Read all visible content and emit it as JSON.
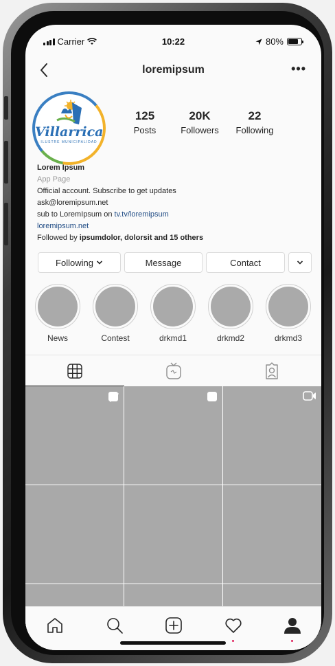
{
  "status_bar": {
    "carrier": "Carrier",
    "time": "10:22",
    "battery": "80%",
    "battery_level": 0.8
  },
  "header": {
    "username": "loremipsum",
    "more": "•••"
  },
  "profile": {
    "logo": {
      "text": "Villarrica",
      "subtitle": "ILUSTRE MUNICIPALIDAD"
    },
    "stats": [
      {
        "value": "125",
        "label": "Posts"
      },
      {
        "value": "20K",
        "label": "Followers"
      },
      {
        "value": "22",
        "label": "Following"
      }
    ],
    "name": "Lorem Ipsum",
    "category": "App Page",
    "bio_line": "Official account. Subscribe to get updates",
    "email": "ask@loremipsum.net",
    "sub_prefix": "sub to LoremIpsum on ",
    "sub_link": "tv.tv/loremipsum",
    "website": "loremipsum.net",
    "followed_prefix": "Followed by ",
    "followed_names": "ipsumdolor, dolorsit and 15 others"
  },
  "actions": {
    "following": "Following",
    "message": "Message",
    "contact": "Contact"
  },
  "highlights": [
    "News",
    "Contest",
    "drkmd1",
    "drkmd2",
    "drkmd3"
  ],
  "tabs": [
    "grid-icon",
    "igtv-icon",
    "tagged-icon"
  ],
  "grid_icons": [
    "multiple-icon",
    "multiple-icon",
    "video-icon",
    "",
    "",
    "",
    "",
    "",
    ""
  ],
  "bottom_nav": [
    "home-icon",
    "search-icon",
    "add-icon",
    "heart-icon",
    "profile-icon"
  ]
}
